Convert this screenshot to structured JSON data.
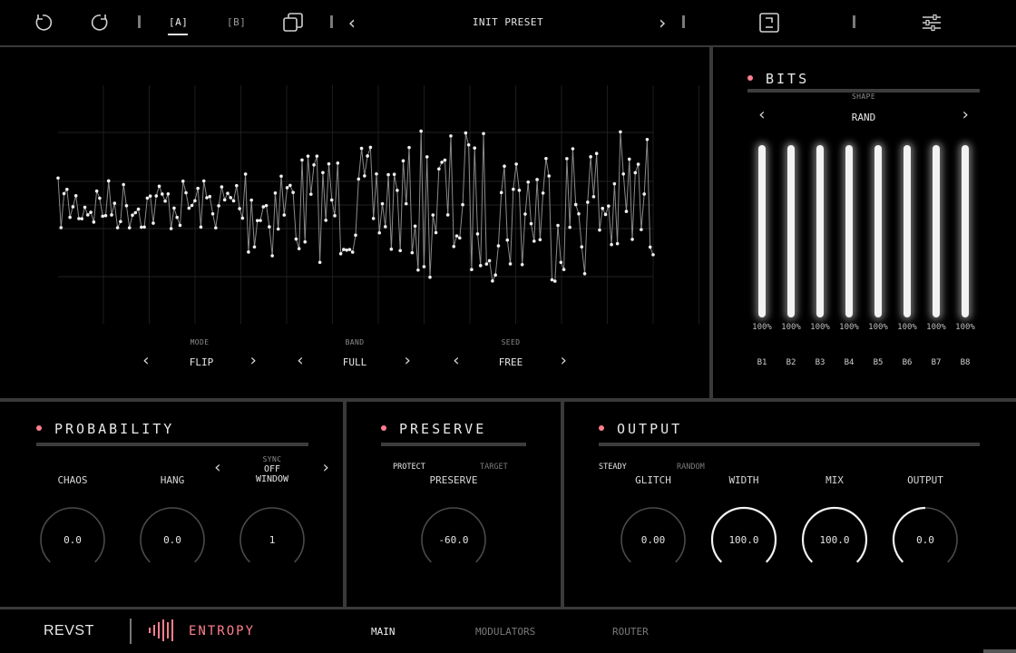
{
  "topbar": {
    "preset_a": "[A]",
    "preset_b": "[B]",
    "preset_name": "INIT PRESET"
  },
  "scope": {
    "mode": {
      "label": "MODE",
      "value": "FLIP"
    },
    "band": {
      "label": "BAND",
      "value": "FULL"
    },
    "seed": {
      "label": "SEED",
      "value": "FREE"
    }
  },
  "bits": {
    "title": "BITS",
    "shape_label": "SHAPE",
    "shape_value": "RAND",
    "columns": [
      {
        "pct": "100%",
        "name": "B1",
        "level": 1.0
      },
      {
        "pct": "100%",
        "name": "B2",
        "level": 1.0
      },
      {
        "pct": "100%",
        "name": "B3",
        "level": 1.0
      },
      {
        "pct": "100%",
        "name": "B4",
        "level": 1.0
      },
      {
        "pct": "100%",
        "name": "B5",
        "level": 1.0
      },
      {
        "pct": "100%",
        "name": "B6",
        "level": 1.0
      },
      {
        "pct": "100%",
        "name": "B7",
        "level": 1.0
      },
      {
        "pct": "100%",
        "name": "B8",
        "level": 1.0
      }
    ]
  },
  "probability": {
    "title": "PROBABILITY",
    "chaos": {
      "label": "CHAOS",
      "value": "0.0",
      "level": 0.0
    },
    "hang": {
      "label": "HANG",
      "value": "0.0",
      "level": 0.0
    },
    "sync_label": "SYNC",
    "sync_value_line1": "OFF",
    "sync_value_line2": "WINDOW",
    "window": {
      "value": "1",
      "level": 0.0
    }
  },
  "preserve": {
    "title": "PRESERVE",
    "opt_protect": "PROTECT",
    "opt_target": "TARGET",
    "knob": {
      "label": "PRESERVE",
      "value": "-60.0",
      "level": 0.0
    }
  },
  "output": {
    "title": "OUTPUT",
    "opt_steady": "STEADY",
    "opt_random": "RANDOM",
    "glitch": {
      "label": "GLITCH",
      "value": "0.00",
      "level": 0.0
    },
    "width": {
      "label": "WIDTH",
      "value": "100.0",
      "level": 1.0
    },
    "mix": {
      "label": "MIX",
      "value": "100.0",
      "level": 1.0
    },
    "out": {
      "label": "OUTPUT",
      "value": "0.0",
      "level": 0.5
    }
  },
  "footer": {
    "brand": "REVST",
    "product": "ENTROPY",
    "tabs": [
      "MAIN",
      "MODULATORS",
      "ROUTER"
    ],
    "active_tab": "MAIN"
  },
  "colors": {
    "accent": "#ff7f8f",
    "panel_border": "#3a3a3a",
    "text": "#e6e6e6",
    "muted": "#8c8c8c"
  }
}
